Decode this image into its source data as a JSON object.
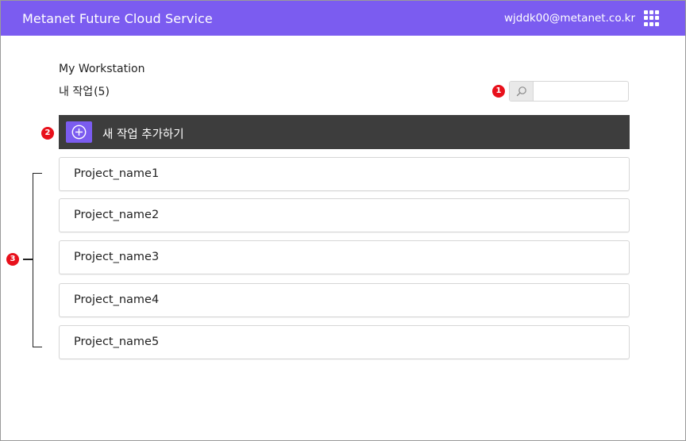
{
  "header": {
    "app_title": "Metanet Future Cloud Service",
    "user_email": "wjddk00@metanet.co.kr",
    "apps_icon": "grid-apps-icon"
  },
  "workspace": {
    "title": "My Workstation",
    "list_label": "내 작업",
    "list_count": "(5)"
  },
  "search": {
    "icon": "search-icon",
    "value": "",
    "placeholder": ""
  },
  "add_task": {
    "icon": "plus-circle-icon",
    "label": "새 작업 추가하기"
  },
  "markers": [
    "1",
    "2",
    "3"
  ],
  "projects": [
    {
      "name": "Project_name1"
    },
    {
      "name": "Project_name2"
    },
    {
      "name": "Project_name3"
    },
    {
      "name": "Project_name4"
    },
    {
      "name": "Project_name5"
    }
  ],
  "colors": {
    "header_bg": "#7b5cf0",
    "accent": "#7b5cf0",
    "add_bar_bg": "#3d3d3d",
    "marker_red": "#e8101b"
  }
}
